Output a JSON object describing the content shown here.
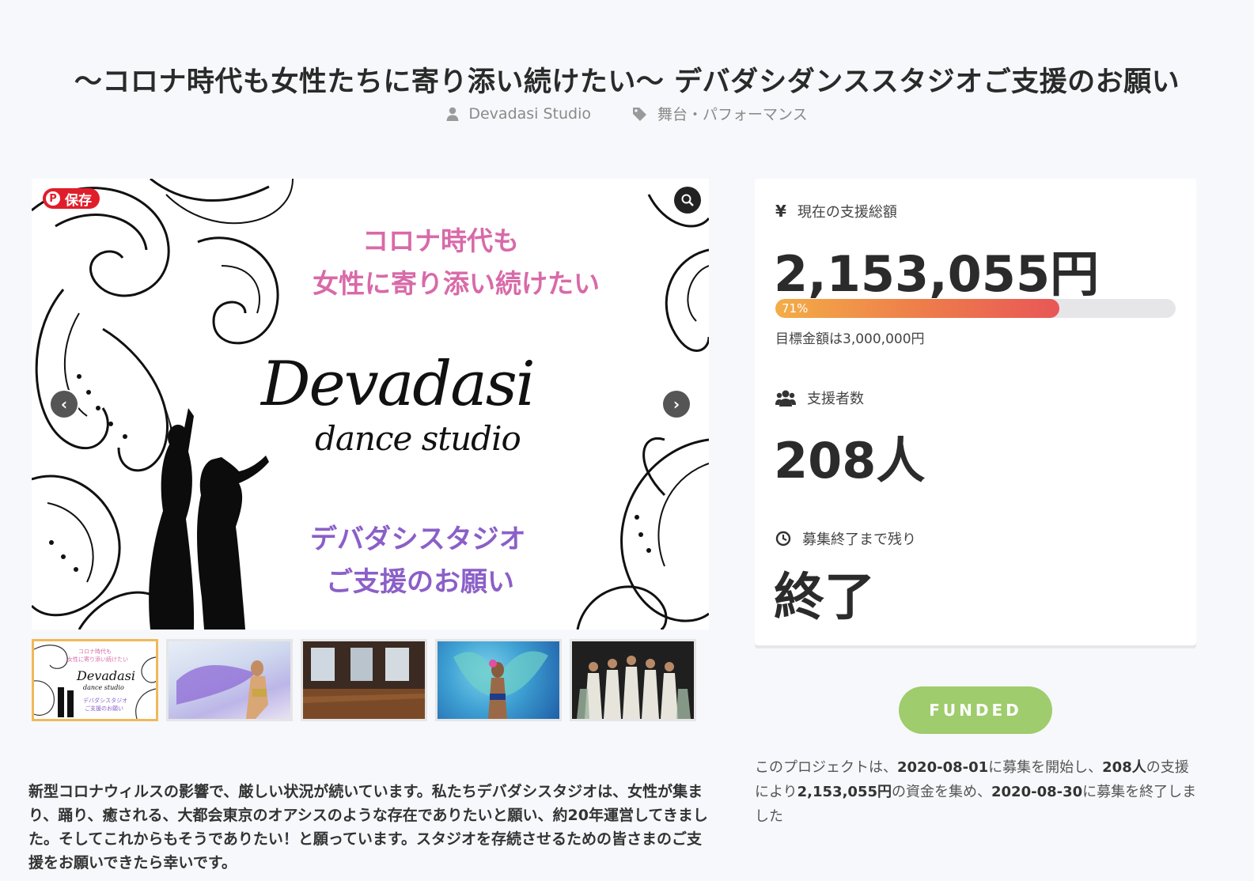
{
  "project": {
    "title": "〜コロナ時代も女性たちに寄り添い続けたい〜 デバダシダンススタジオご支援のお願い",
    "author": "Devadasi Studio",
    "category": "舞台・パフォーマンス"
  },
  "hero": {
    "save_label": "保存",
    "line1": "コロナ時代も",
    "line2": "女性に寄り添い続けたい",
    "logo_main": "Devadasi",
    "logo_sub": "dance studio",
    "line3": "デバダシスタジオ",
    "line4": "ご支援のお願い",
    "prev_icon": "chevron-left-icon",
    "next_icon": "chevron-right-icon"
  },
  "thumb_labels": {
    "t1_line1": "コロナ時代も",
    "t1_line2": "女性に寄り添い続けたい",
    "t1_logo": "Devadasi",
    "t1_sub": "dance studio",
    "t1_line3": "デバダシスタジオ",
    "t1_line4": "ご支援のお願い"
  },
  "stats": {
    "total_label": "現在の支援総額",
    "total_value": "2,153,055円",
    "progress_percent": 71,
    "progress_label": "71%",
    "goal_text": "目標金額は3,000,000円",
    "backers_label": "支援者数",
    "backers_value": "208人",
    "remaining_label": "募集終了まで残り",
    "remaining_value": "終了"
  },
  "funded_label": "FUNDED",
  "summary": {
    "p1": "このプロジェクトは、",
    "start": "2020-08-01",
    "p2": "に募集を開始し、",
    "backers": "208人",
    "p3": "の支援により",
    "amount": "2,153,055円",
    "p4": "の資金を集め、",
    "end": "2020-08-30",
    "p5": "に募集を終了しました"
  },
  "description": "新型コロナウィルスの影響で、厳しい状況が続いています。私たちデバダシスタジオは、女性が集まり、踊り、癒される、大都会東京のオアシスのような存在でありたいと願い、約20年運営してきました。そしてこれからもそうでありたい！と願っています。スタジオを存続させるための皆さまのご支援をお願いできたら幸いです。",
  "colors": {
    "accent_orange": "#f3ad48",
    "accent_red": "#e85757",
    "funded_green": "#9fcc6c",
    "pink_text": "#d86aa9",
    "purple_text": "#8b5fc8"
  }
}
